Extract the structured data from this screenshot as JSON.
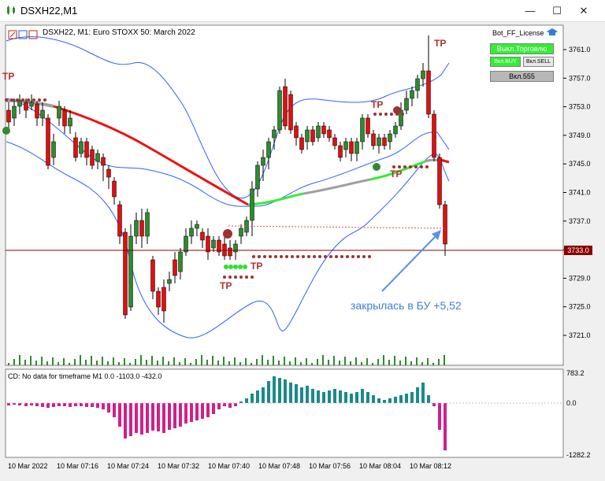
{
  "window": {
    "title": "DSXH22,M1",
    "minimize": "—",
    "maximize": "☐",
    "close": "✕"
  },
  "chart": {
    "symbol_label": "DSXH22, M1:  Euro STOXX 50: March 2022",
    "license_label": "Bot_FF_License",
    "btn_trade_off": "Выкл.Торговлю",
    "btn_buy": "Вкл.BUY",
    "btn_sell": "Вкл.SELL",
    "btn_555": "Вкл.555",
    "annotation": "закрылась в БУ +5,52",
    "current_price": "3733.0",
    "tp_labels": [
      "TP",
      "TP",
      "TP",
      "TP",
      "TP",
      "TP"
    ],
    "y_ticks": [
      "3761.0",
      "3757.0",
      "3753.0",
      "3749.0",
      "3745.0",
      "3741.0",
      "3737.0",
      "3733.0",
      "3729.0",
      "3725.0",
      "3721.0"
    ],
    "x_ticks": [
      "10 Mar 2022",
      "10 Mar 07:16",
      "10 Mar 07:24",
      "10 Mar 07:32",
      "10 Mar 07:40",
      "10 Mar 07:48",
      "10 Mar 07:56",
      "10 Mar 08:04",
      "10 Mar 08:12"
    ],
    "colors": {
      "bull": "#2e8b2e",
      "bear": "#e01010",
      "band": "#3060ff",
      "ma_red": "#ee1111",
      "ma_green": "#33ee33"
    }
  },
  "indicator": {
    "label": "CD: No data for timeframe M1 0.0 -1103.0 -432.0",
    "y_ticks": [
      "783.2",
      "0.0",
      "-1282.2"
    ]
  }
}
